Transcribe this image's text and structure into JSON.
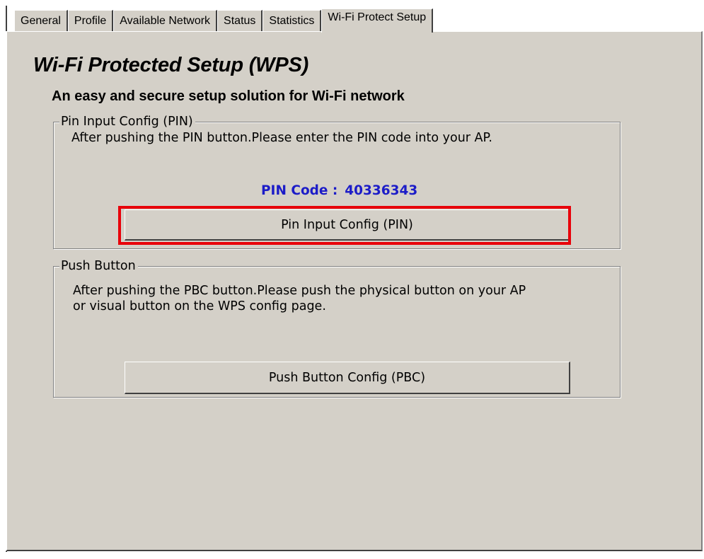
{
  "tabs": [
    {
      "label": "General"
    },
    {
      "label": "Profile"
    },
    {
      "label": "Available Network"
    },
    {
      "label": "Status"
    },
    {
      "label": "Statistics"
    },
    {
      "label": "Wi-Fi Protect Setup",
      "active": true
    }
  ],
  "page": {
    "title": "Wi-Fi Protected Setup (WPS)",
    "subtitle": "An easy and secure setup solution for Wi-Fi network"
  },
  "pin_group": {
    "legend": "Pin Input Config (PIN)",
    "description": "After pushing the PIN button.Please enter the PIN code into your AP.",
    "pin_label": "PIN Code :",
    "pin_value": "40336343",
    "button_label": "Pin Input Config (PIN)"
  },
  "pbc_group": {
    "legend": "Push Button",
    "description_line1": "After pushing the PBC button.Please push the physical button on your AP",
    "description_line2": "or visual button on the WPS config page.",
    "button_label": "Push Button Config (PBC)"
  },
  "colors": {
    "panel_background": "#d4d0c8",
    "pin_code_text": "#1c1cc8",
    "highlight_border": "#e8000a"
  }
}
